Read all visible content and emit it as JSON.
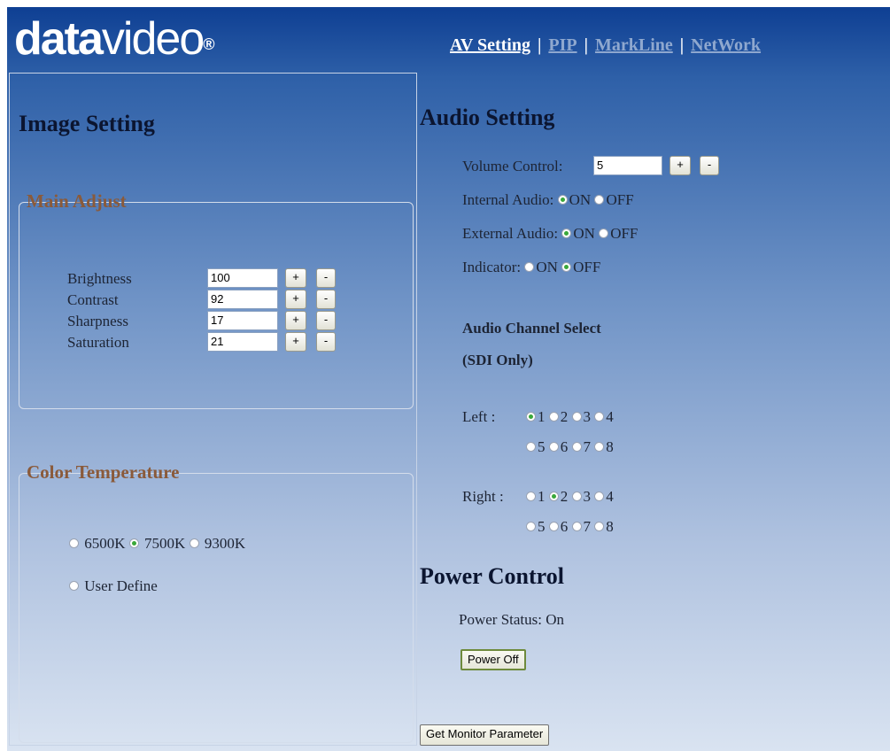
{
  "header": {
    "logo_part1": "data",
    "logo_part2": "video",
    "logo_reg": "®",
    "nav": [
      {
        "label": "AV Setting",
        "active": true
      },
      {
        "label": "PIP",
        "active": false
      },
      {
        "label": "MarkLine",
        "active": false
      },
      {
        "label": "NetWork",
        "active": false
      }
    ],
    "separator": "|"
  },
  "image_setting": {
    "title": "Image Setting",
    "main_adjust": {
      "legend": "Main Adjust",
      "rows": [
        {
          "label": "Brightness",
          "value": "100"
        },
        {
          "label": "Contrast",
          "value": "92"
        },
        {
          "label": "Sharpness",
          "value": "17"
        },
        {
          "label": "Saturation",
          "value": "21"
        }
      ],
      "plus_label": "+",
      "minus_label": "-"
    },
    "color_temperature": {
      "legend": "Color Temperature",
      "options": [
        {
          "label": "6500K",
          "checked": false
        },
        {
          "label": "7500K",
          "checked": true
        },
        {
          "label": "9300K",
          "checked": false
        }
      ],
      "user_define": {
        "label": "User Define",
        "checked": false
      }
    }
  },
  "audio_setting": {
    "title": "Audio Setting",
    "volume": {
      "label": "Volume Control:",
      "value": "5",
      "plus": "+",
      "minus": "-"
    },
    "internal": {
      "label": "Internal Audio:",
      "on_label": "ON",
      "off_label": "OFF",
      "value": "ON"
    },
    "external": {
      "label": "External Audio:",
      "on_label": "ON",
      "off_label": "OFF",
      "value": "ON"
    },
    "indicator": {
      "label": "Indicator:",
      "on_label": "ON",
      "off_label": "OFF",
      "value": "OFF"
    },
    "channel_title": "Audio Channel Select",
    "channel_subtitle": "(SDI Only)",
    "left": {
      "label": "Left :",
      "selected": "1"
    },
    "right": {
      "label": "Right :",
      "selected": "2"
    },
    "channels_row1": [
      "1",
      "2",
      "3",
      "4"
    ],
    "channels_row2": [
      "5",
      "6",
      "7",
      "8"
    ]
  },
  "power_control": {
    "title": "Power Control",
    "status_label": "Power Status:",
    "status_value": "On",
    "button_label": "Power Off"
  },
  "footer": {
    "get_params_label": "Get Monitor Parameter"
  }
}
